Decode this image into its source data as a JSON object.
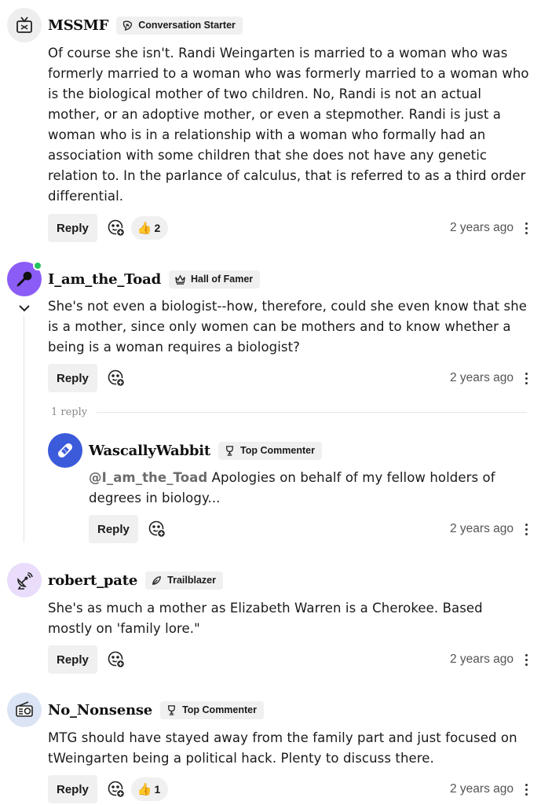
{
  "comments": [
    {
      "username": "MSSMF",
      "badge": "Conversation Starter",
      "badge_icon": "conversation-starter-icon",
      "avatar_icon": "tv-icon",
      "avatar_bg": "#eeeeee",
      "text": "Of course she isn't. Randi Weingarten is married to a woman who was formerly married to a woman who was formerly married to a woman who is the biological mother of two children. No, Randi is not an actual mother, or an adoptive mother, or even a stepmother. Randi is just a woman who is in a relationship with a woman who formally had an association with some children that she does not have any genetic relation to. In the parlance of calculus, that is referred to as a third order differential.",
      "reply_label": "Reply",
      "reaction_count": "2",
      "timestamp": "2 years ago"
    },
    {
      "username": "I_am_the_Toad",
      "badge": "Hall of Famer",
      "badge_icon": "crown-icon",
      "avatar_icon": "microphone-icon",
      "avatar_bg": "#8b5cf6",
      "online": true,
      "text": "She's not even a biologist--how, therefore, could she even know that she is a mother, since only women can be mothers and to know whether a being is a woman requires a biologist?",
      "reply_label": "Reply",
      "timestamp": "2 years ago",
      "replies_label": "1 reply"
    },
    {
      "username": "WascallyWabbit",
      "badge": "Top Commenter",
      "badge_icon": "trophy-icon",
      "avatar_icon": "bandage-icon",
      "avatar_bg": "#3b5bdb",
      "mention": "@I_am_the_Toad",
      "text": " Apologies on behalf of my fellow holders of degrees in biology...",
      "reply_label": "Reply",
      "timestamp": "2 years ago"
    },
    {
      "username": "robert_pate",
      "badge": "Trailblazer",
      "badge_icon": "trailblazer-icon",
      "avatar_icon": "satellite-icon",
      "avatar_bg": "#e9ddfb",
      "text": "She's as much a mother as Elizabeth Warren is a Cherokee. Based mostly on 'family lore.\"",
      "reply_label": "Reply",
      "timestamp": "2 years ago"
    },
    {
      "username": "No_Nonsense",
      "badge": "Top Commenter",
      "badge_icon": "trophy-icon",
      "avatar_icon": "radio-icon",
      "avatar_bg": "#dbe4f5",
      "text": "MTG should have stayed away from the family part and just focused on tWeingarten being a political hack. Plenty to discuss there.",
      "reply_label": "Reply",
      "reaction_count": "1",
      "timestamp": "2 years ago"
    }
  ]
}
